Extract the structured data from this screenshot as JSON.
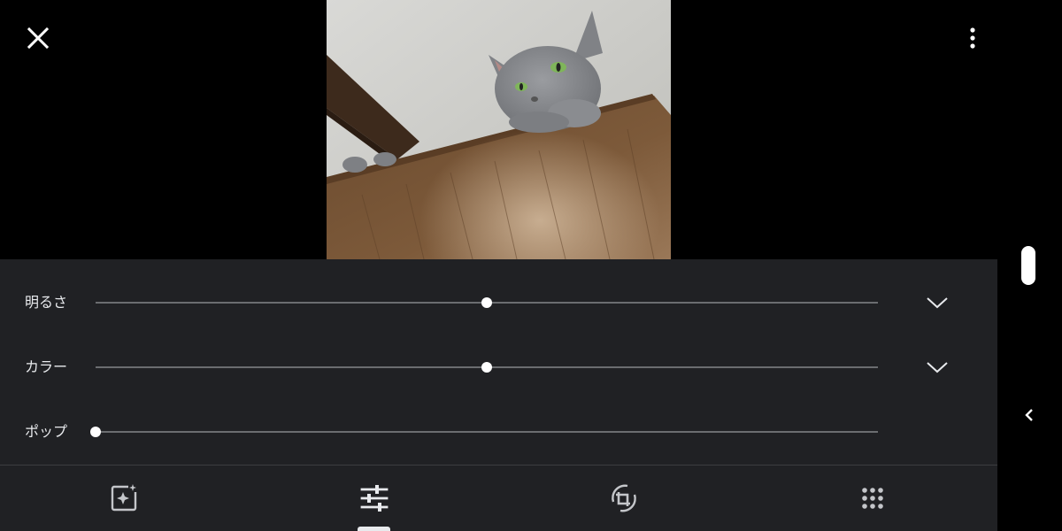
{
  "toolbar": {
    "close_icon": "close-icon",
    "more_icon": "more-vert-icon"
  },
  "photo": {
    "description_icon": "photo-preview"
  },
  "adjustments": {
    "rows": [
      {
        "label": "明るさ",
        "value": 0.5,
        "expandable": true
      },
      {
        "label": "カラー",
        "value": 0.5,
        "expandable": true
      },
      {
        "label": "ポップ",
        "value": 0.0,
        "expandable": false
      }
    ]
  },
  "bottom_tools": [
    {
      "name": "suggestions",
      "icon": "auto-fix-icon",
      "active": false
    },
    {
      "name": "adjust",
      "icon": "tune-icon",
      "active": true
    },
    {
      "name": "crop",
      "icon": "crop-rotate-icon",
      "active": false
    },
    {
      "name": "filters",
      "icon": "filters-grid-icon",
      "active": false
    }
  ],
  "colors": {
    "panel": "#202124",
    "track": "#6b6d70",
    "thumb": "#ffffff",
    "text": "#e8eaed",
    "background": "#000000"
  }
}
